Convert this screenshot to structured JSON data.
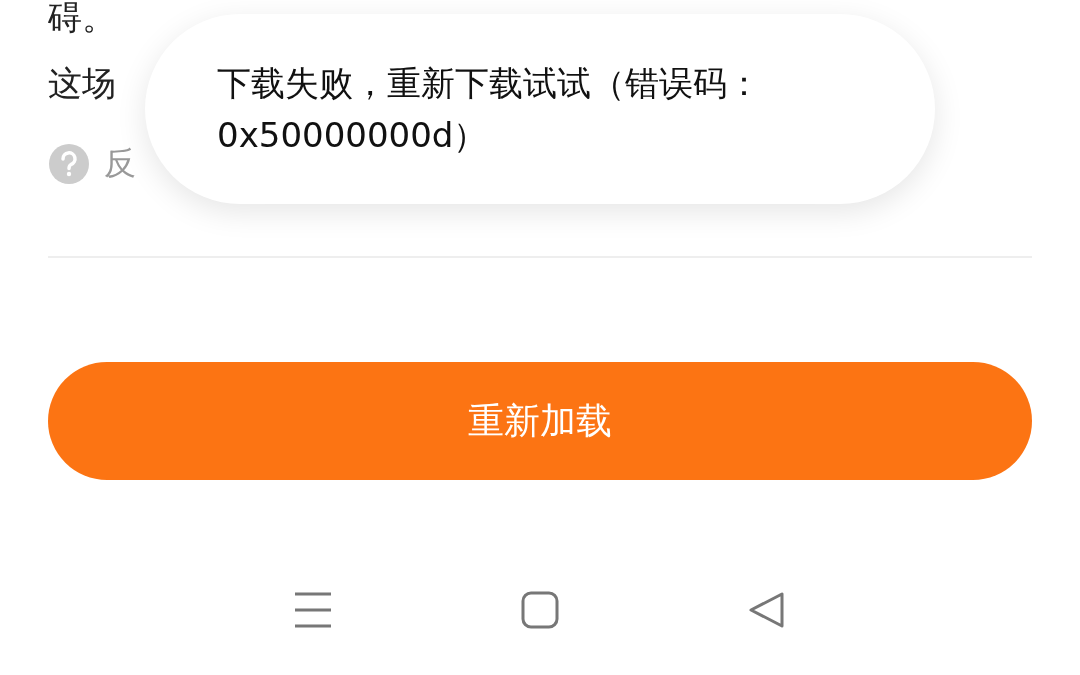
{
  "content": {
    "lines": [
      "碍。",
      "这场"
    ],
    "feedback": {
      "label": "反"
    }
  },
  "toast": {
    "message": "下载失败，重新下载试试（错误码：0x50000000d）"
  },
  "reload_button": {
    "label": "重新加载"
  },
  "nav_bar": {
    "buttons": [
      {
        "kind": "menu"
      },
      {
        "kind": "home"
      },
      {
        "kind": "back"
      }
    ]
  }
}
